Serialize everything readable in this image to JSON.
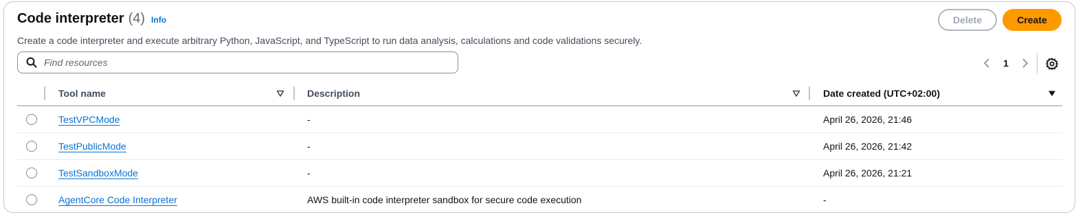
{
  "header": {
    "title": "Code interpreter",
    "count": "(4)",
    "info_label": "Info",
    "description": "Create a code interpreter and execute arbitrary Python, JavaScript, and TypeScript to run data analysis, calculations and code validations securely.",
    "delete_label": "Delete",
    "create_label": "Create"
  },
  "search": {
    "placeholder": "Find resources",
    "value": ""
  },
  "pagination": {
    "current_page": "1"
  },
  "table": {
    "columns": [
      {
        "label": "Tool name"
      },
      {
        "label": "Description"
      },
      {
        "label": "Date created (UTC+02:00)"
      }
    ],
    "rows": [
      {
        "name": "TestVPCMode",
        "description": "-",
        "date": "April 26, 2026, 21:46"
      },
      {
        "name": "TestPublicMode",
        "description": "-",
        "date": "April 26, 2026, 21:42"
      },
      {
        "name": "TestSandboxMode",
        "description": "-",
        "date": "April 26, 2026, 21:21"
      },
      {
        "name": "AgentCore Code Interpreter",
        "description": "AWS built-in code interpreter sandbox for secure code execution",
        "date": "-"
      }
    ]
  },
  "colors": {
    "accent_primary": "#ff9900",
    "link": "#0972d3",
    "border": "#c6c6cd"
  },
  "icons": [
    "search-icon",
    "chevron-left-icon",
    "chevron-right-icon",
    "settings-gear-icon",
    "sort-caret-icon"
  ]
}
